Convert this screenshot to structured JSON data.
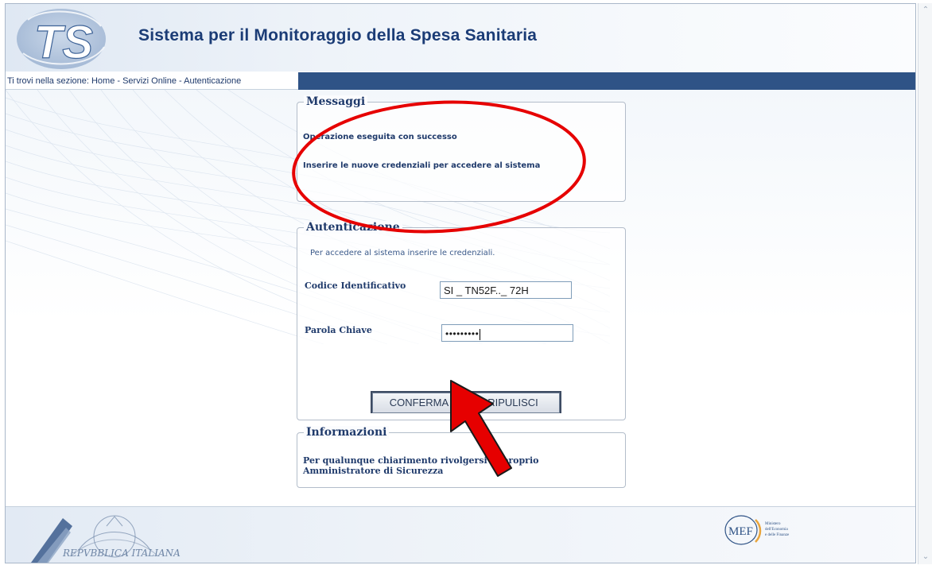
{
  "header": {
    "title": "Sistema per il Monitoraggio della Spesa Sanitaria",
    "logo_text": "TS"
  },
  "breadcrumb": {
    "text": "Ti trovi nella sezione: Home - Servizi Online - Autenticazione"
  },
  "messages": {
    "legend": "Messaggi",
    "lines": [
      "Operazione eseguita con successo",
      "Inserire le nuove credenziali per accedere al sistema"
    ]
  },
  "auth": {
    "legend": "Autenticazione",
    "intro": "Per accedere al sistema inserire le credenziali.",
    "code_label": "Codice Identificativo",
    "code_value": "SI _ TN52F.._ 72H",
    "password_label": "Parola Chiave",
    "password_value": "•••••••••",
    "confirm_button": "CONFERMA",
    "clear_button": "RIPULISCI"
  },
  "info": {
    "legend": "Informazioni",
    "line1": "Per qualunque chiarimento rivolgersi al proprio",
    "line2": "Amministratore di Sicurezza"
  },
  "footer": {
    "emblem_text": "REPVBBLICA ITALIANA",
    "mef_text": "MEF",
    "mef_sub": [
      "Ministero",
      "dell'Economia",
      "e delle Finanze"
    ]
  },
  "colors": {
    "brand_blue": "#1b3c76",
    "crumb_bar": "#2f5386",
    "annotation_red": "#e60000"
  },
  "icons": {
    "scroll_up": "chevron-up-icon",
    "scroll_down": "chevron-down-icon"
  }
}
